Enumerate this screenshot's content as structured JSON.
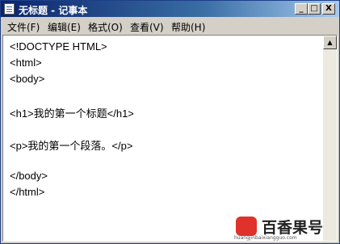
{
  "window": {
    "title": "无标题 - 记事本",
    "buttons": {
      "minimize": "_",
      "maximize": "□",
      "close": "X"
    }
  },
  "menu": {
    "items": [
      {
        "label": "文件(F)"
      },
      {
        "label": "编辑(E)"
      },
      {
        "label": "格式(O)"
      },
      {
        "label": "查看(V)"
      },
      {
        "label": "帮助(H)"
      }
    ]
  },
  "editor": {
    "lines": [
      "<!DOCTYPE HTML>",
      "<html>",
      "<body>",
      "",
      "<h1>我的第一个标题</h1>",
      "",
      "<p>我的第一个段落。</p>",
      "",
      "</body>",
      "</html>"
    ]
  },
  "watermark": {
    "brand": "百香果号",
    "url": "huangjinbaixiangguo.com"
  },
  "colors": {
    "titlebar_start": "#0a246a",
    "titlebar_end": "#a6caf0",
    "window_face": "#d4d0c8",
    "watermark_logo": "#e0322b"
  }
}
